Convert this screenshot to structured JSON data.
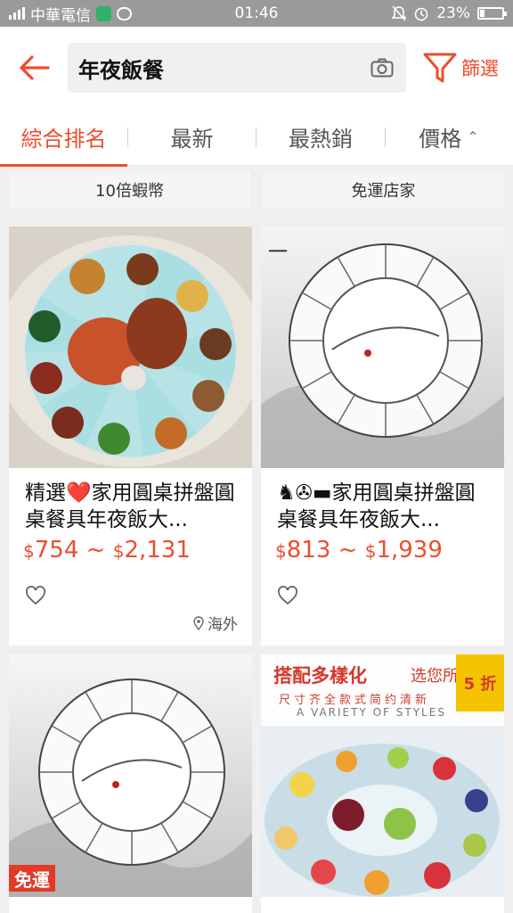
{
  "status_bar": {
    "carrier": "中華電信",
    "time": "01:46",
    "battery": "23%"
  },
  "header": {
    "search_query": "年夜飯餐",
    "filter_label": "篩選",
    "accent_color": "#ee4d2d"
  },
  "sort_tabs": [
    {
      "label": "綜合排名",
      "active": true
    },
    {
      "label": "最新",
      "active": false
    },
    {
      "label": "最熱銷",
      "active": false
    },
    {
      "label": "價格",
      "active": false
    }
  ],
  "chips": [
    "10倍蝦幣",
    "免運店家"
  ],
  "products": [
    {
      "title": "精選❤️家用圓桌拼盤圓桌餐具年夜飯大...",
      "price_low": "754",
      "price_high": "2,131",
      "currency": "$",
      "location": "海外"
    },
    {
      "title": "♞✇▬家用圓桌拼盤圓桌餐具年夜飯大...",
      "price_low": "813",
      "price_high": "1,939",
      "currency": "$",
      "location": ""
    },
    {
      "badge": "免運"
    },
    {
      "promo_title": "搭配多樣化",
      "promo_sub": "选您所",
      "promo_line": "尺寸齐全款式简约清新",
      "promo_eng": "A VARIETY OF STYLES",
      "discount": "5 折"
    }
  ]
}
